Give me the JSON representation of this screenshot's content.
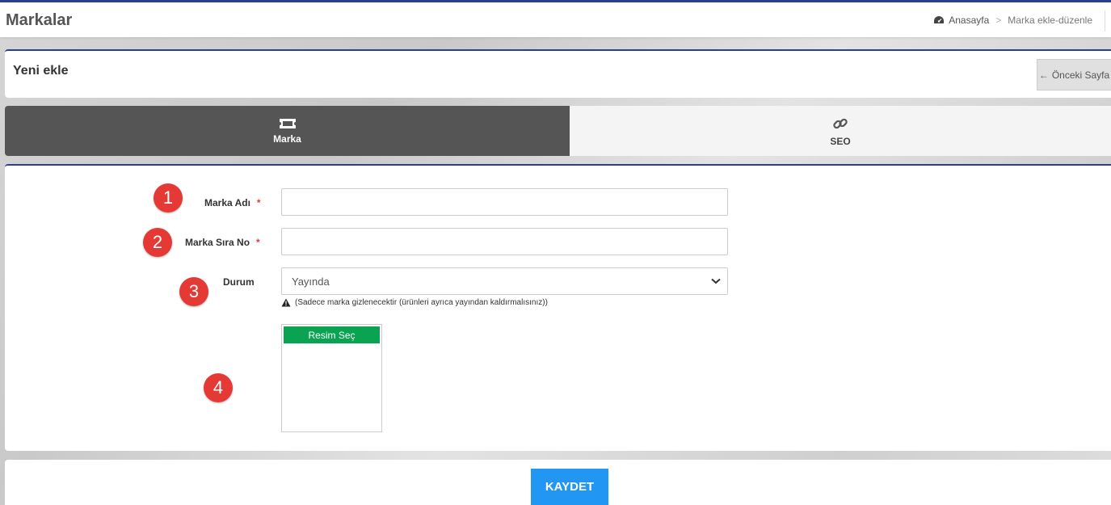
{
  "header": {
    "title": "Markalar",
    "breadcrumb": {
      "home": "Anasayfa",
      "separator": ">",
      "current": "Marka ekle-düzenle"
    }
  },
  "card": {
    "title": "Yeni ekle",
    "back_label": "Önceki Sayfa"
  },
  "tabs": [
    {
      "label": "Marka",
      "icon": "ticket-icon",
      "active": true
    },
    {
      "label": "SEO",
      "icon": "link-icon",
      "active": false
    }
  ],
  "form": {
    "badges": [
      "1",
      "2",
      "3",
      "4"
    ],
    "brand_name": {
      "label": "Marka Adı",
      "required": "*",
      "value": ""
    },
    "order_no": {
      "label": "Marka Sıra No",
      "required": "*",
      "value": ""
    },
    "status": {
      "label": "Durum",
      "selected": "Yayında",
      "hint": "(Sadece marka gizlenecektir (ürünleri ayrıca yayından kaldırmalısınız))"
    },
    "image": {
      "button_label": "Resim Seç"
    }
  },
  "footer": {
    "save_label": "KAYDET"
  },
  "colors": {
    "accent": "#2c3e8c",
    "badge": "#e53935",
    "save": "#2196f3",
    "image_button": "#0aa351",
    "active_tab": "#555555"
  }
}
